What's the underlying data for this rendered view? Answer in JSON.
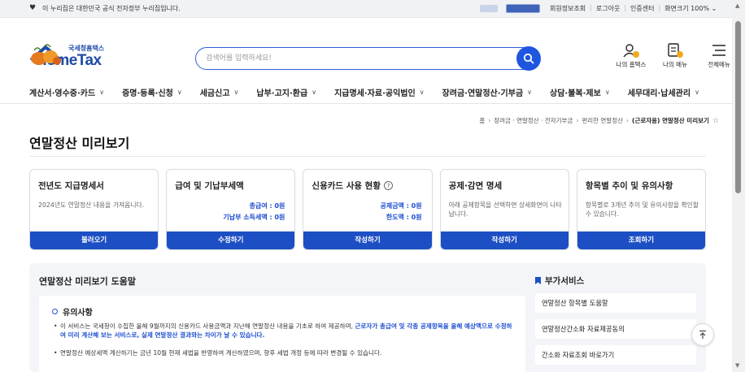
{
  "gov_bar": {
    "flag": "♥",
    "text": "이 누리집은 대한민국 공식 전자정부 누리집입니다.",
    "util": [
      "회원정보조회",
      "로그아웃",
      "인증센터",
      "화면크기 100% ⌄"
    ]
  },
  "logo": {
    "small": "국세청홈택스",
    "big": "HomeTax"
  },
  "search": {
    "placeholder": "검색어를 입력하세요!"
  },
  "header_icons": [
    {
      "label": "나의 홈택스",
      "icon": "user-icon"
    },
    {
      "label": "나의 메뉴",
      "icon": "my-menu-icon"
    },
    {
      "label": "전체메뉴",
      "icon": "hamburger-icon"
    }
  ],
  "nav": [
    "계산서·영수증·카드",
    "증명·등록·신청",
    "세금신고",
    "납부·고지·환급",
    "지급명세·자료·공익법인",
    "장려금·연말정산·기부금",
    "상담·불복·제보",
    "세무대리·납세관리"
  ],
  "breadcrumb": {
    "items": [
      "홈",
      "장려금 · 연말정산 · 전자기부금",
      "편리한 연말정산"
    ],
    "current": "(근로자용) 연말정산 미리보기"
  },
  "page_title": "연말정산 미리보기",
  "cards": [
    {
      "title": "전년도 지급명세서",
      "desc": "2024년도 연말정산 내용을 가져옵니다.",
      "button": "불러오기"
    },
    {
      "title": "급여 및 기납부세액",
      "amount1": "총급여 : 0원",
      "amount2": "기납부 소득세액 : 0원",
      "button": "수정하기"
    },
    {
      "title": "신용카드 사용 현황",
      "amount1": "공제금액 : 0원",
      "amount2": "한도액 : 0원",
      "button": "작성하기"
    },
    {
      "title": "공제·감면 명세",
      "desc": "아래 공제항목을 선택하면 상세화면이 나타납니다.",
      "button": "작성하기"
    },
    {
      "title": "항목별 추이 및 유의사항",
      "desc": "항목별로 3개년 추이 및 유의사항을 확인할 수 있습니다.",
      "button": "조회하기"
    }
  ],
  "help": {
    "title": "연말정산 미리보기 도움말",
    "notice_title": "유의사항",
    "bullet1_a": "이 서비스는 국세청이 수집한 올해 9월까지의 신용카드 사용금액과 지난해 연말정산 내용을 기초로 하여 제공하며, ",
    "bullet1_b": "근로자가 총급여 및 각종 공제항목을 올해 예상액으로 수정하여 미리 계산해 보는 서비스로, 실제 연말정산 결과와는 차이가 날 수 있습니다.",
    "bullet2": "연말정산 예상세액 계산하기는 금년 10월 현재 세법을 반영하여 계산하였으며, 향후 세법 개정 등에 따라 변경될 수 있습니다."
  },
  "addon": {
    "title": "부가서비스",
    "items": [
      "연말정산 항목별 도움말",
      "연말정산간소화 자료제공동의",
      "간소화 자료조회 바로가기"
    ]
  }
}
